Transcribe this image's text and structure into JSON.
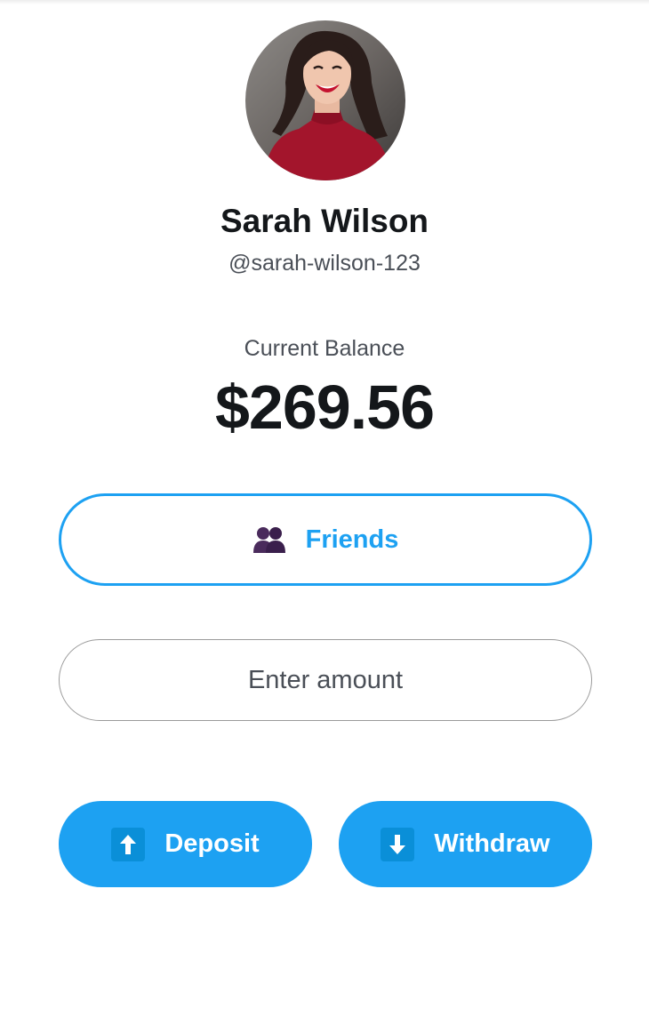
{
  "profile": {
    "name": "Sarah Wilson",
    "handle": "@sarah-wilson-123"
  },
  "balance": {
    "label": "Current Balance",
    "amount": "$269.56"
  },
  "friends_button": {
    "label": "Friends",
    "icon": "two-people-icon"
  },
  "amount_input": {
    "placeholder": "Enter amount",
    "value": ""
  },
  "actions": {
    "deposit_label": "Deposit",
    "deposit_icon": "arrow-up-icon",
    "withdraw_label": "Withdraw",
    "withdraw_icon": "arrow-down-icon"
  },
  "colors": {
    "accent": "#1da1f2",
    "text_primary": "#14171a",
    "text_secondary": "#4a4f57"
  }
}
